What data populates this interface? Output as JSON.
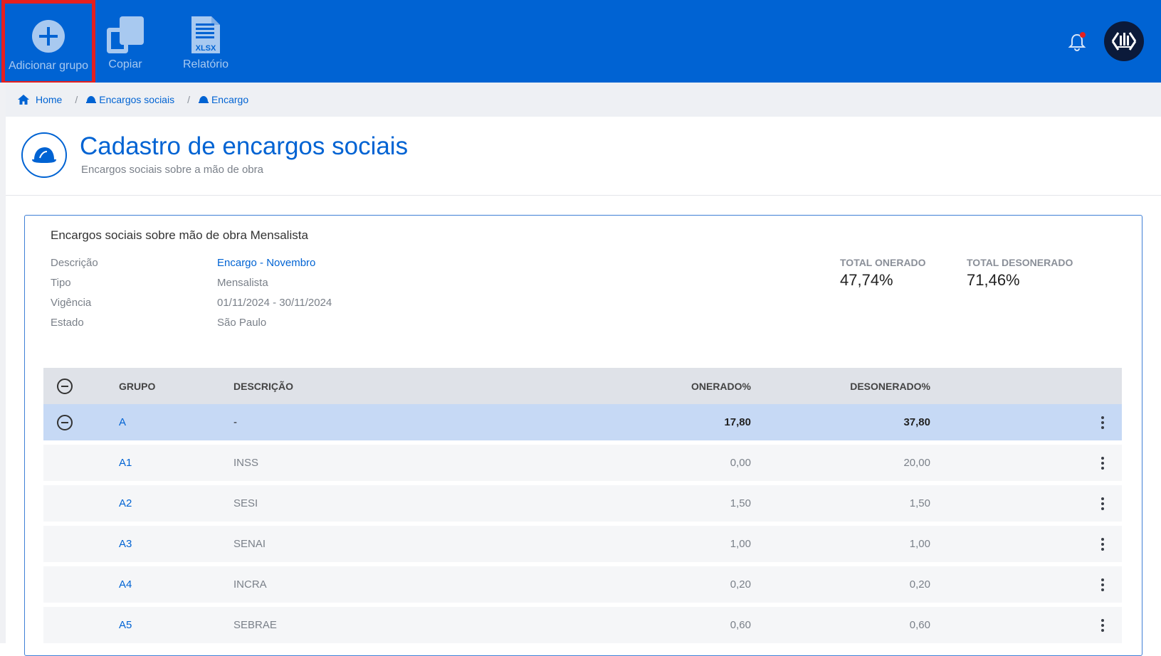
{
  "toolbar": {
    "add_group_label": "Adicionar grupo",
    "copy_label": "Copiar",
    "report_label": "Relatório",
    "report_icon_text": "XLSX"
  },
  "breadcrumb": {
    "home": "Home",
    "level1": "Encargos sociais",
    "level2": "Encargo",
    "separator": "/"
  },
  "header": {
    "title": "Cadastro de encargos sociais",
    "subtitle": "Encargos sociais sobre a mão de obra"
  },
  "card": {
    "title": "Encargos sociais sobre mão de obra Mensalista",
    "fields": {
      "descricao_label": "Descrição",
      "descricao_value": "Encargo - Novembro",
      "tipo_label": "Tipo",
      "tipo_value": "Mensalista",
      "vigencia_label": "Vigência",
      "vigencia_value": "01/11/2024 - 30/11/2024",
      "estado_label": "Estado",
      "estado_value": "São Paulo"
    },
    "totals": {
      "onerado_label": "TOTAL ONERADO",
      "onerado_value": "47,74%",
      "desonerado_label": "TOTAL DESONERADO",
      "desonerado_value": "71,46%"
    }
  },
  "table": {
    "headers": {
      "grupo": "GRUPO",
      "descricao": "DESCRIÇÃO",
      "onerado": "ONERADO%",
      "desonerado": "DESONERADO%"
    },
    "group": {
      "grupo": "A",
      "descricao": "-",
      "onerado": "17,80",
      "desonerado": "37,80"
    },
    "rows": [
      {
        "grupo": "A1",
        "descricao": "INSS",
        "onerado": "0,00",
        "desonerado": "20,00"
      },
      {
        "grupo": "A2",
        "descricao": "SESI",
        "onerado": "1,50",
        "desonerado": "1,50"
      },
      {
        "grupo": "A3",
        "descricao": "SENAI",
        "onerado": "1,00",
        "desonerado": "1,00"
      },
      {
        "grupo": "A4",
        "descricao": "INCRA",
        "onerado": "0,20",
        "desonerado": "0,20"
      },
      {
        "grupo": "A5",
        "descricao": "SEBRAE",
        "onerado": "0,60",
        "desonerado": "0,60"
      }
    ]
  },
  "colors": {
    "brand": "#0063d3",
    "highlight_border": "#e51f1f",
    "notification_dot": "#e51f1f",
    "group_row": "#c6d9f5"
  }
}
